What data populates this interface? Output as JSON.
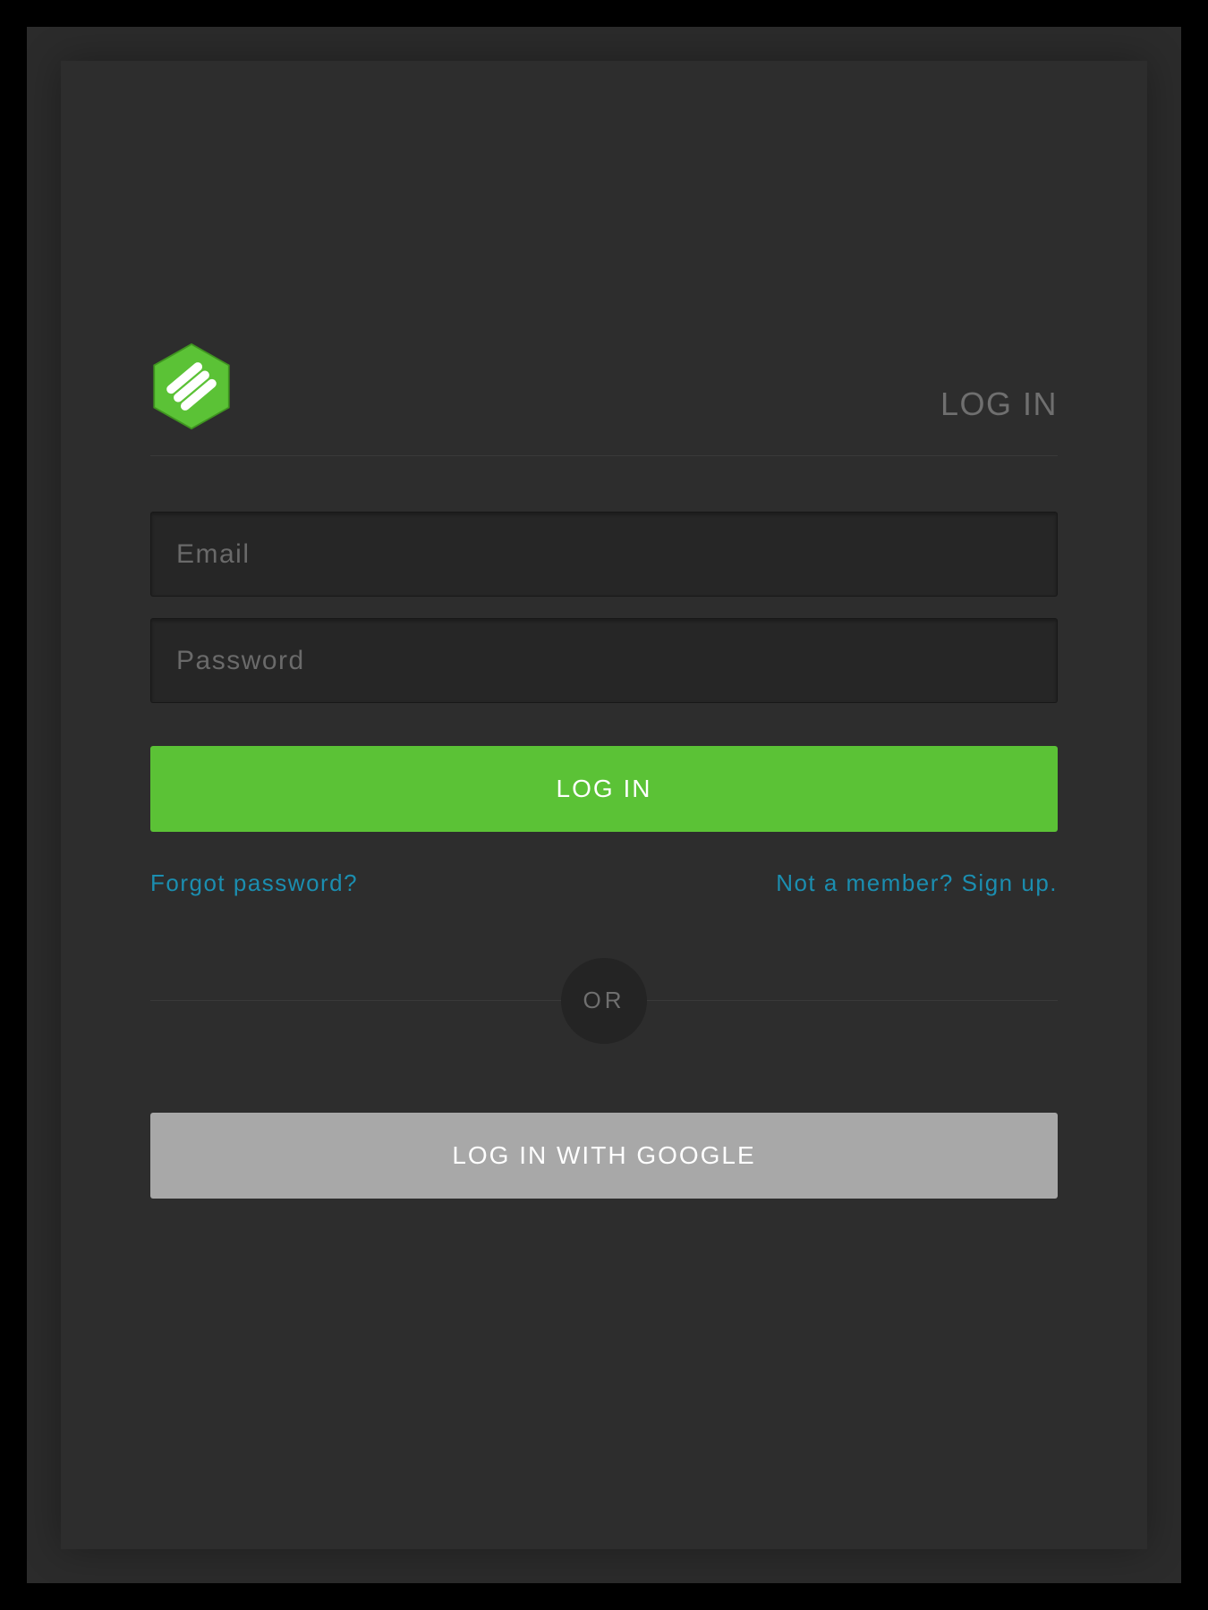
{
  "header": {
    "title": "LOG IN"
  },
  "form": {
    "email_placeholder": "Email",
    "password_placeholder": "Password",
    "login_button": "LOG IN",
    "forgot_link": "Forgot password?",
    "signup_link": "Not a member? Sign up."
  },
  "divider": {
    "or_label": "OR"
  },
  "oauth": {
    "google_button": "LOG IN WITH GOOGLE"
  },
  "colors": {
    "accent_green": "#5bc236",
    "link_teal": "#1b8eb0",
    "bg_dark": "#2d2d2d"
  }
}
